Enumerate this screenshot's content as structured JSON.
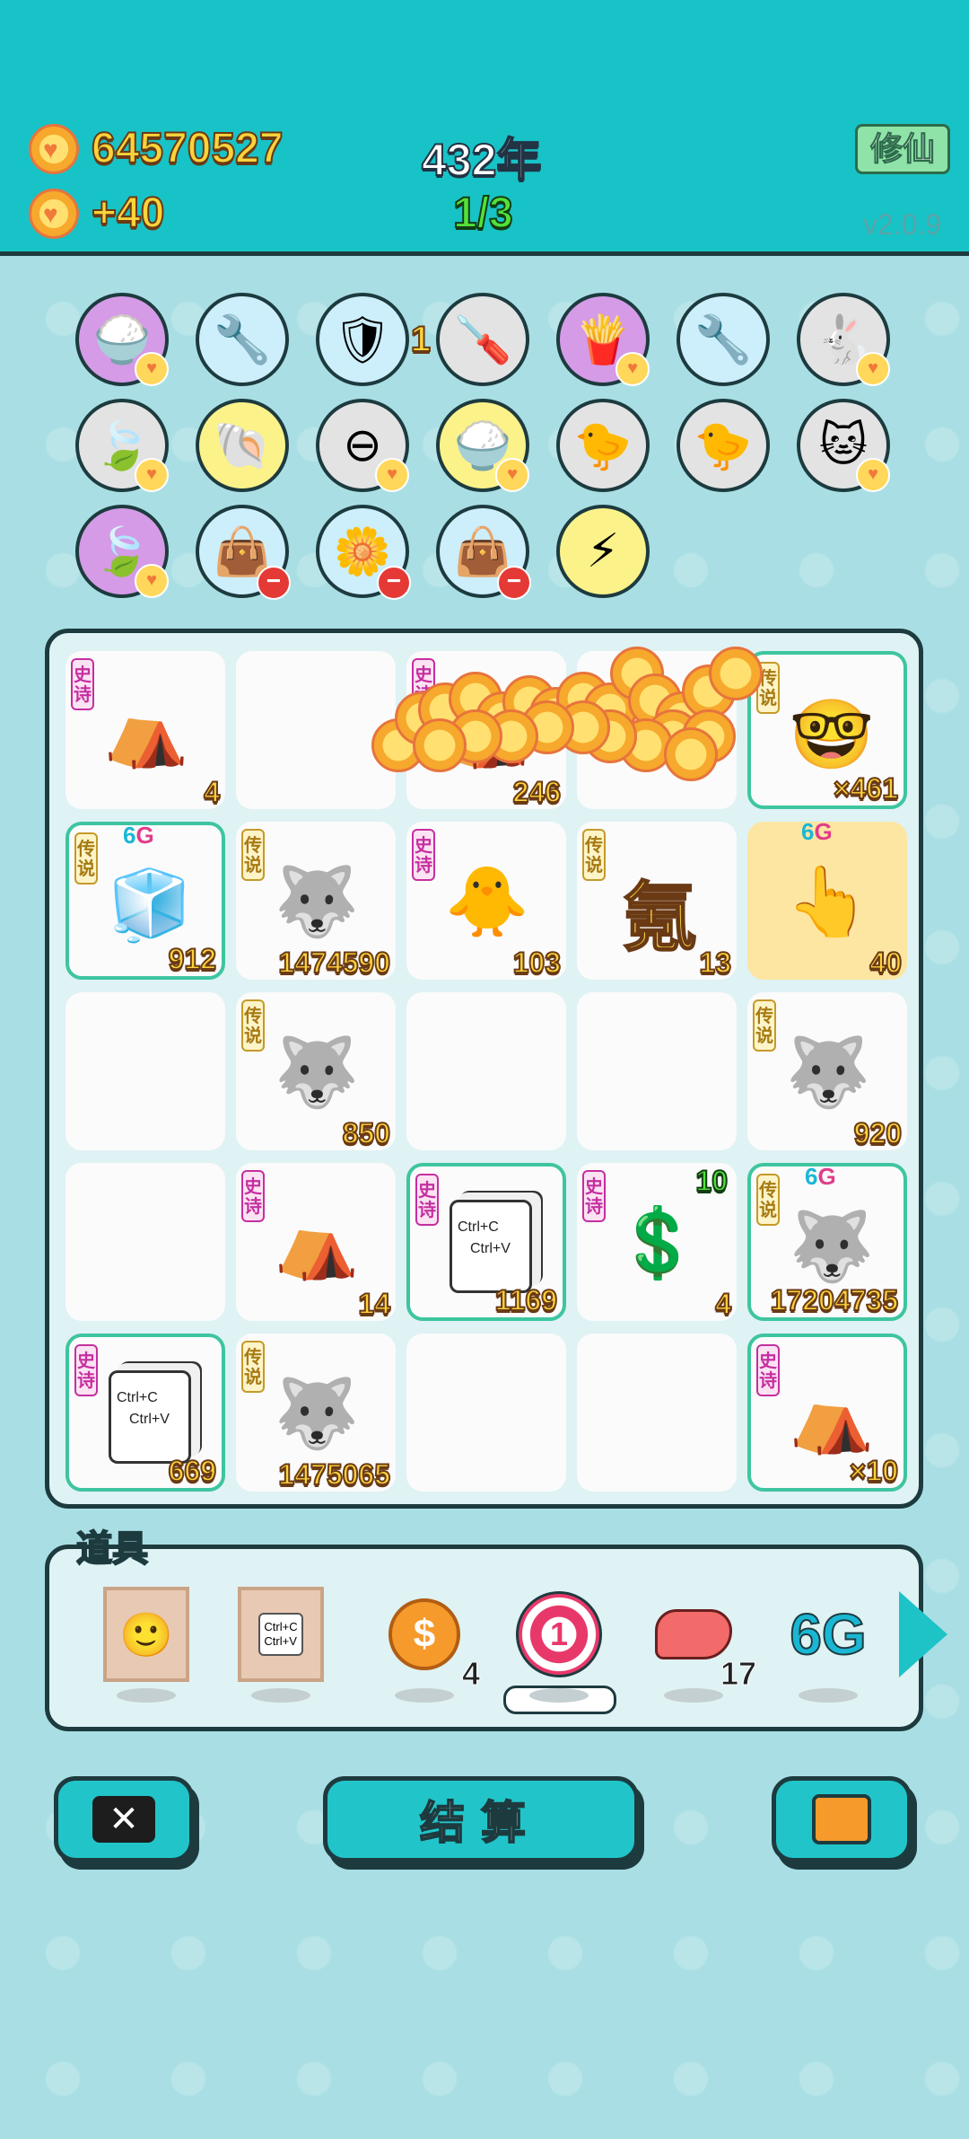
{
  "header": {
    "coins": "64570527",
    "coin_rate": "+40",
    "year": "432年",
    "progress": "1/3",
    "cultivate_button": "修仙",
    "version": "v2.0.9"
  },
  "top_icons": [
    {
      "name": "rice-bowl-icon",
      "glyph": "🍚",
      "bg": "#d59be6",
      "badge": "heart"
    },
    {
      "name": "pump-icon",
      "glyph": "🔧",
      "bg": "#cdeefb",
      "badge": ""
    },
    {
      "name": "shield-icon",
      "glyph": "🛡",
      "bg": "#cdeefb",
      "badge": "",
      "count": "1"
    },
    {
      "name": "screwdriver-icon",
      "glyph": "🪛",
      "bg": "#e3e3e3",
      "badge": ""
    },
    {
      "name": "fries-icon",
      "glyph": "🍟",
      "bg": "#d59be6",
      "badge": "heart"
    },
    {
      "name": "pump-icon",
      "glyph": "🔧",
      "bg": "#cdeefb",
      "badge": ""
    },
    {
      "name": "rabbit-icon",
      "glyph": "🐇",
      "bg": "#e3e3e3",
      "badge": "heart"
    },
    {
      "name": "leaf-icon",
      "glyph": "🍃",
      "bg": "#e3e3e3",
      "badge": "heart"
    },
    {
      "name": "shell-icon",
      "glyph": "🐚",
      "bg": "#fbf28a",
      "badge": ""
    },
    {
      "name": "minus-sign-icon",
      "glyph": "⊖",
      "bg": "#e3e3e3",
      "badge": "heart"
    },
    {
      "name": "rice-bowl-icon",
      "glyph": "🍚",
      "bg": "#fbf28a",
      "badge": "heart"
    },
    {
      "name": "chick-icon",
      "glyph": "🐤",
      "bg": "#e3e3e3",
      "badge": ""
    },
    {
      "name": "chick-icon",
      "glyph": "🐤",
      "bg": "#e3e3e3",
      "badge": ""
    },
    {
      "name": "cats-icon",
      "glyph": "🐱",
      "bg": "#e3e3e3",
      "badge": "heart"
    },
    {
      "name": "leaf-icon",
      "glyph": "🍃",
      "bg": "#d59be6",
      "badge": "heart"
    },
    {
      "name": "bag-icon",
      "glyph": "👜",
      "bg": "#cdeefb",
      "badge": "minus"
    },
    {
      "name": "flower-pot-icon",
      "glyph": "🌼",
      "bg": "#cdeefb",
      "badge": "minus"
    },
    {
      "name": "bag-icon",
      "glyph": "👜",
      "bg": "#cdeefb",
      "badge": "minus"
    },
    {
      "name": "lightning-icon",
      "glyph": "⚡",
      "bg": "#fbf28a",
      "badge": ""
    }
  ],
  "tags": {
    "epic": "史诗",
    "legend": "传说"
  },
  "board": [
    {
      "tag": "epic",
      "art": "⛺",
      "label": "tent-icon",
      "num": "4",
      "style": ""
    },
    {
      "tag": "",
      "art": "",
      "label": "empty",
      "num": "",
      "style": ""
    },
    {
      "tag": "epic",
      "art": "⛺",
      "label": "tent-icon",
      "num": "246",
      "style": ""
    },
    {
      "tag": "",
      "art": "",
      "label": "empty",
      "num": "",
      "style": ""
    },
    {
      "tag": "legend",
      "art": "🤓",
      "label": "king-face-icon",
      "num": "×461",
      "style": "green"
    },
    {
      "tag": "legend",
      "art": "🧊",
      "label": "fridge-icon",
      "num": "912",
      "style": "green",
      "sixg": true
    },
    {
      "tag": "legend",
      "art": "🐺",
      "label": "husky-icon",
      "num": "1474590",
      "style": ""
    },
    {
      "tag": "epic",
      "art": "🐥",
      "label": "chick-icon",
      "num": "103",
      "style": ""
    },
    {
      "tag": "legend",
      "art": "",
      "label": "char-icon",
      "char": "氪",
      "num": "13",
      "style": ""
    },
    {
      "tag": "",
      "art": "👆",
      "label": "finger-icon",
      "num": "40",
      "style": "yellow",
      "sixg": true
    },
    {
      "tag": "",
      "art": "",
      "label": "empty",
      "num": "",
      "style": ""
    },
    {
      "tag": "legend",
      "art": "🐺",
      "label": "husky-icon",
      "num": "850",
      "style": ""
    },
    {
      "tag": "",
      "art": "",
      "label": "empty",
      "num": "",
      "style": ""
    },
    {
      "tag": "",
      "art": "",
      "label": "empty",
      "num": "",
      "style": ""
    },
    {
      "tag": "legend",
      "art": "🐺",
      "label": "husky-icon",
      "num": "920",
      "style": ""
    },
    {
      "tag": "",
      "art": "",
      "label": "empty",
      "num": "",
      "style": ""
    },
    {
      "tag": "epic",
      "art": "⛺",
      "label": "tent-icon",
      "num": "14",
      "style": ""
    },
    {
      "tag": "epic",
      "art": "📋",
      "label": "copy-paste-icon",
      "num": "1169",
      "style": "green"
    },
    {
      "tag": "epic",
      "art": "💲",
      "label": "dollar-coin-icon",
      "num": "4",
      "style": "",
      "ten": "10"
    },
    {
      "tag": "legend",
      "art": "🐺",
      "label": "husky-icon",
      "num": "17204735",
      "style": "green",
      "sixg": true
    },
    {
      "tag": "epic",
      "art": "📋",
      "label": "copy-paste-icon",
      "num": "669",
      "style": "green"
    },
    {
      "tag": "legend",
      "art": "🐺",
      "label": "husky-icon",
      "num": "1475065",
      "style": ""
    },
    {
      "tag": "",
      "art": "",
      "label": "empty",
      "num": "",
      "style": ""
    },
    {
      "tag": "",
      "art": "",
      "label": "empty",
      "num": "",
      "style": ""
    },
    {
      "tag": "epic",
      "art": "⛺",
      "label": "tent-icon",
      "num": "×10",
      "style": "green"
    }
  ],
  "six_g": {
    "six": "6",
    "g": "G"
  },
  "ctrl": {
    "c": "Ctrl+C",
    "v": "Ctrl+V"
  },
  "tools": {
    "title": "道具",
    "items": [
      {
        "name": "face-frame-icon",
        "glyph": "🙂",
        "count": ""
      },
      {
        "name": "copy-frame-icon",
        "glyph": "📋",
        "count": ""
      },
      {
        "name": "dollar-coin-icon",
        "glyph": "💲",
        "count": "4"
      },
      {
        "name": "target-icon",
        "glyph": "①",
        "count": ""
      },
      {
        "name": "liver-icon",
        "glyph": "🫀",
        "count": "17"
      },
      {
        "name": "six-g-icon",
        "glyph": "6G",
        "count": ""
      }
    ]
  },
  "buttons": {
    "close": "✕",
    "settle": "结算"
  }
}
